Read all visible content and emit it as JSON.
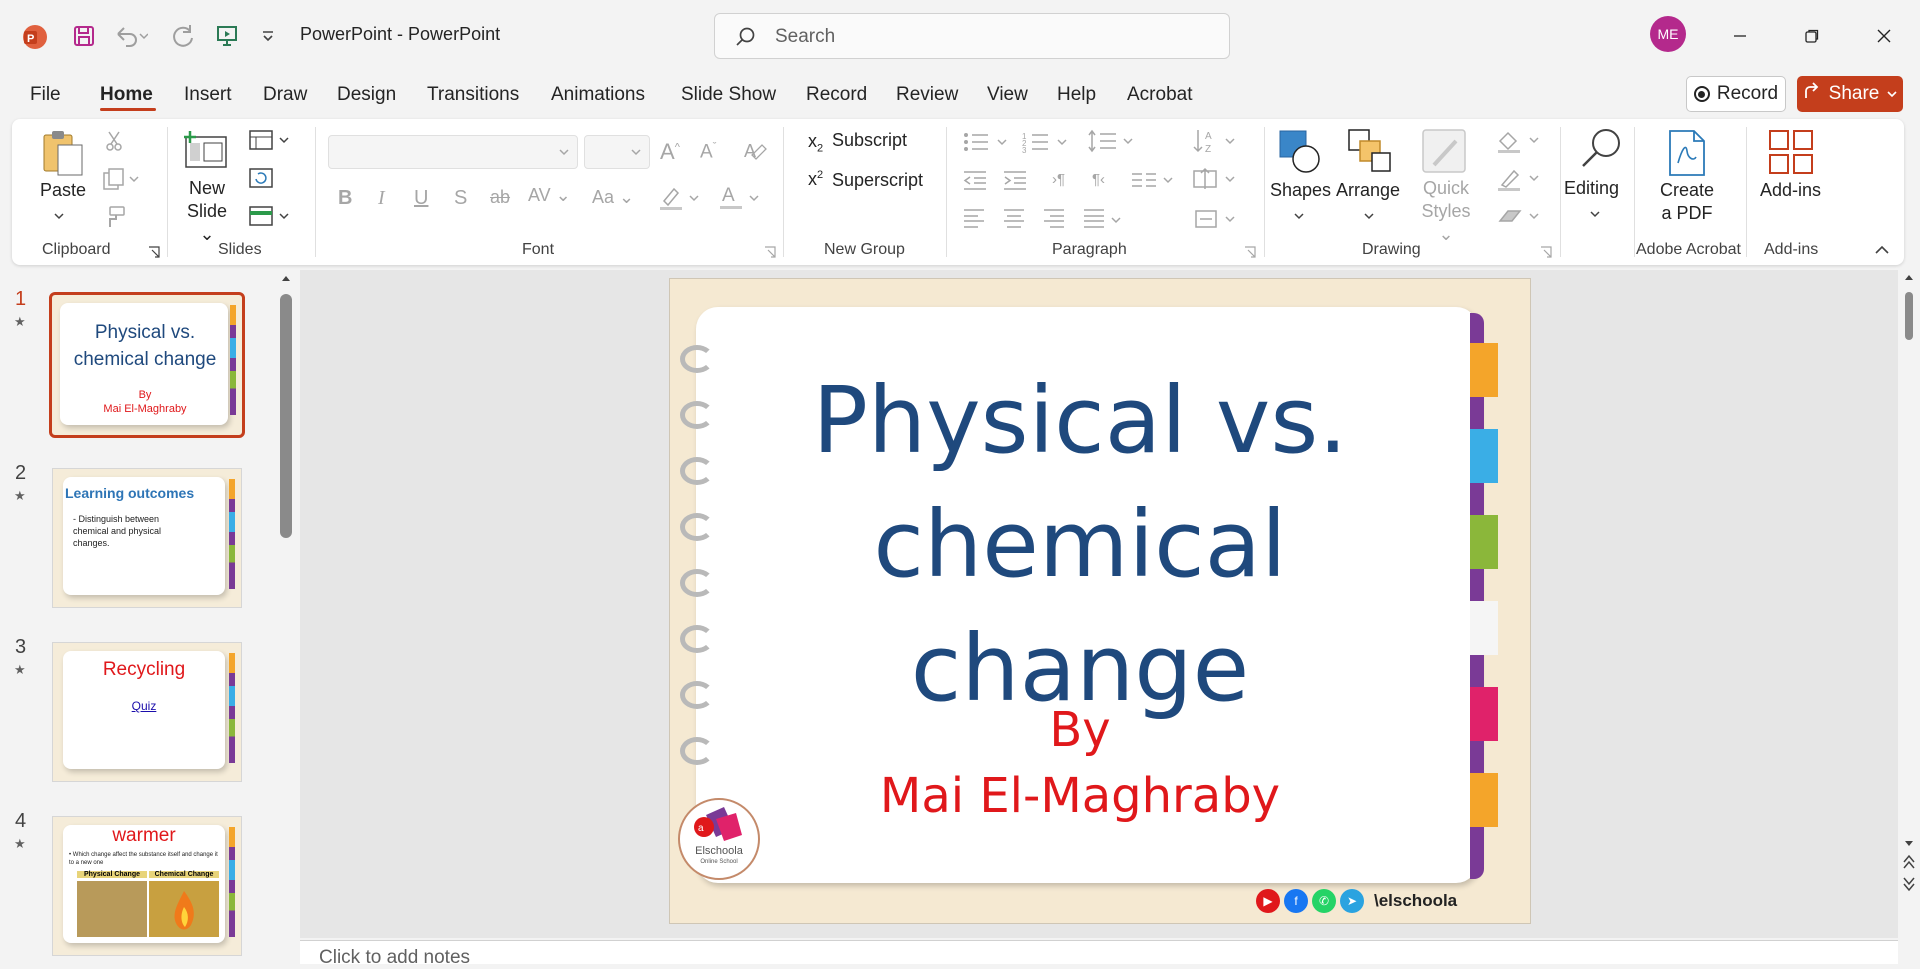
{
  "window": {
    "title": "PowerPoint  -  PowerPoint",
    "user_initials": "ME"
  },
  "search": {
    "placeholder": "Search"
  },
  "tabs": [
    "File",
    "Home",
    "Insert",
    "Draw",
    "Design",
    "Transitions",
    "Animations",
    "Slide Show",
    "Record",
    "Review",
    "View",
    "Help",
    "Acrobat"
  ],
  "actions": {
    "record_label": "Record",
    "share_label": "Share"
  },
  "ribbon": {
    "clipboard": {
      "paste": "Paste",
      "label": "Clipboard"
    },
    "slides": {
      "new_slide_1": "New",
      "new_slide_2": "Slide",
      "label": "Slides"
    },
    "font": {
      "label": "Font"
    },
    "new_group": {
      "subscript": "Subscript",
      "superscript": "Superscript",
      "label": "New Group"
    },
    "paragraph": {
      "label": "Paragraph"
    },
    "drawing": {
      "shapes": "Shapes",
      "arrange": "Arrange",
      "quick_1": "Quick",
      "quick_2": "Styles",
      "label": "Drawing"
    },
    "editing": {
      "label": "Editing"
    },
    "acrobat": {
      "create_1": "Create",
      "create_2": "a PDF",
      "label": "Adobe Acrobat"
    },
    "addins": {
      "button": "Add-ins",
      "label": "Add-ins"
    }
  },
  "thumbnails": [
    {
      "num": "1",
      "title": "Physical vs. chemical change",
      "by": "By",
      "author": "Mai El-Maghraby",
      "selected": true
    },
    {
      "num": "2",
      "title": "Learning outcomes",
      "body": "Distinguish between chemical and physical changes."
    },
    {
      "num": "3",
      "title": "Recycling",
      "link": "Quiz"
    },
    {
      "num": "4",
      "title": "warmer",
      "body": "Which change affect the substance itself and change it to a new one",
      "col1": "Physical Change",
      "col2": "Chemical Change"
    }
  ],
  "slide": {
    "title_line1": "Physical vs.",
    "title_line2": "chemical change",
    "by": "By",
    "author": "Mai El-Maghraby",
    "logo_name": "Elschoola",
    "logo_sub": "Online School",
    "handle": "\\elschoola"
  },
  "notes": {
    "placeholder": "Click to add notes"
  },
  "colors": {
    "accent": "#c43e1c",
    "title_blue": "#1f497d",
    "author_red": "#e0181b"
  }
}
